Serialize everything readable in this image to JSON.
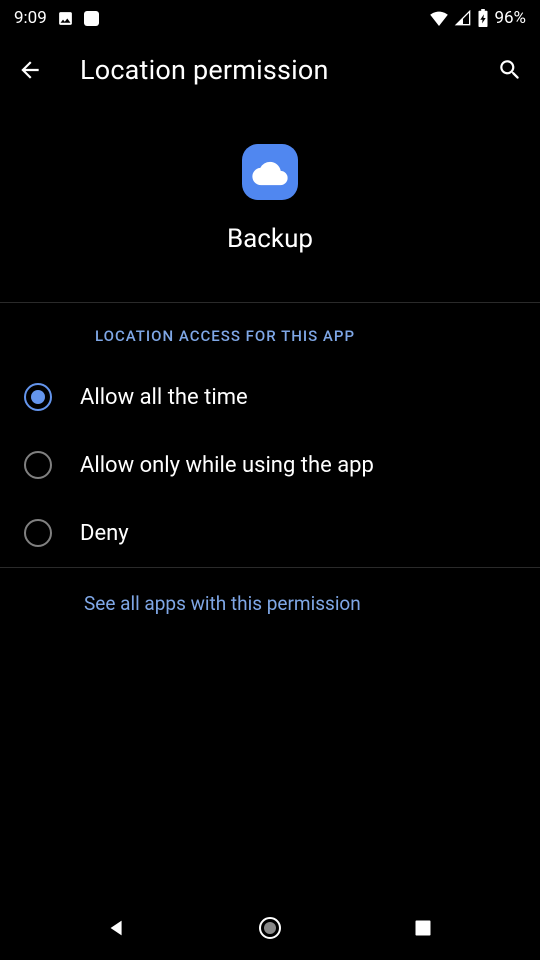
{
  "status_bar": {
    "time": "9:09",
    "battery": "96%"
  },
  "app_bar": {
    "title": "Location permission"
  },
  "app_info": {
    "name": "Backup"
  },
  "section": {
    "header": "LOCATION ACCESS FOR THIS APP"
  },
  "options": [
    {
      "label": "Allow all the time",
      "checked": true
    },
    {
      "label": "Allow only while using the app",
      "checked": false
    },
    {
      "label": "Deny",
      "checked": false
    }
  ],
  "link": {
    "text": "See all apps with this permission"
  }
}
